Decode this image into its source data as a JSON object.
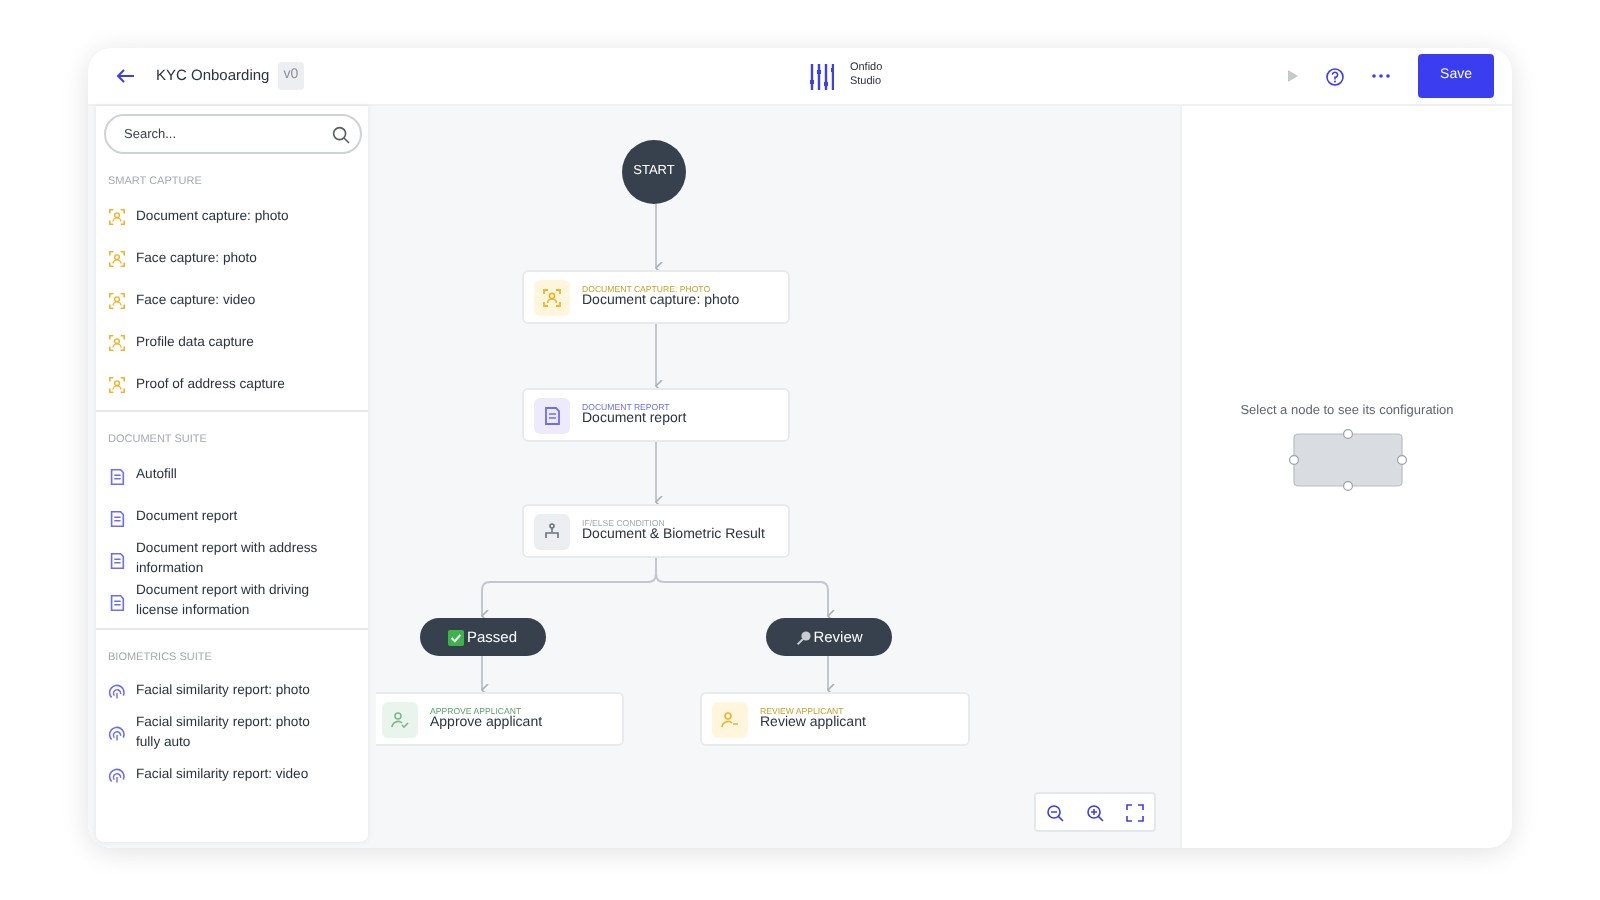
{
  "header": {
    "title": "KYC Onboarding",
    "version": "v0",
    "logo": {
      "line_1": "Onfido",
      "line_2": "Studio"
    },
    "save_button": "Save"
  },
  "sidebar": {
    "search": {
      "placeholder": "Search..."
    },
    "sections": [
      {
        "title": "SMART CAPTURE",
        "items": [
          {
            "label": "Document capture: photo",
            "kind": "capture"
          },
          {
            "label": "Face capture: photo",
            "kind": "capture"
          },
          {
            "label": "Face capture: video",
            "kind": "capture"
          },
          {
            "label": "Profile data capture",
            "kind": "capture"
          },
          {
            "label": "Proof of address capture",
            "kind": "capture"
          }
        ]
      },
      {
        "title": "DOCUMENT SUITE",
        "items": [
          {
            "label": "Autofill",
            "kind": "document"
          },
          {
            "label": "Document report",
            "kind": "document"
          },
          {
            "label": "Document report with address information",
            "kind": "document"
          },
          {
            "label": "Document report with driving license information",
            "kind": "document"
          }
        ]
      },
      {
        "title": "BIOMETRICS SUITE",
        "items": [
          {
            "label": "Facial similarity report: photo",
            "kind": "biometric"
          },
          {
            "label": "Facial similarity report: photo fully auto",
            "kind": "biometric"
          },
          {
            "label": "Facial similarity report: video",
            "kind": "biometric"
          }
        ]
      }
    ]
  },
  "canvas": {
    "start": "START",
    "nodes": [
      {
        "category": "DOCUMENT CAPTURE: PHOTO",
        "title": "Document capture: photo",
        "kind": "capture"
      },
      {
        "category": "DOCUMENT REPORT",
        "title": "Document report",
        "kind": "document"
      },
      {
        "category": "IF/ELSE CONDITION",
        "title": "Document & Biometric Result",
        "kind": "condition"
      },
      {
        "category": "APPROVE APPLICANT",
        "title": "Approve applicant",
        "kind": "approve"
      },
      {
        "category": "REVIEW APPLICANT",
        "title": "Review applicant",
        "kind": "review"
      }
    ],
    "branches": [
      {
        "label": "Passed",
        "kind": "passed"
      },
      {
        "label": "Review",
        "kind": "review"
      }
    ]
  },
  "config_panel": {
    "hint": "Select a node to see its configuration"
  }
}
